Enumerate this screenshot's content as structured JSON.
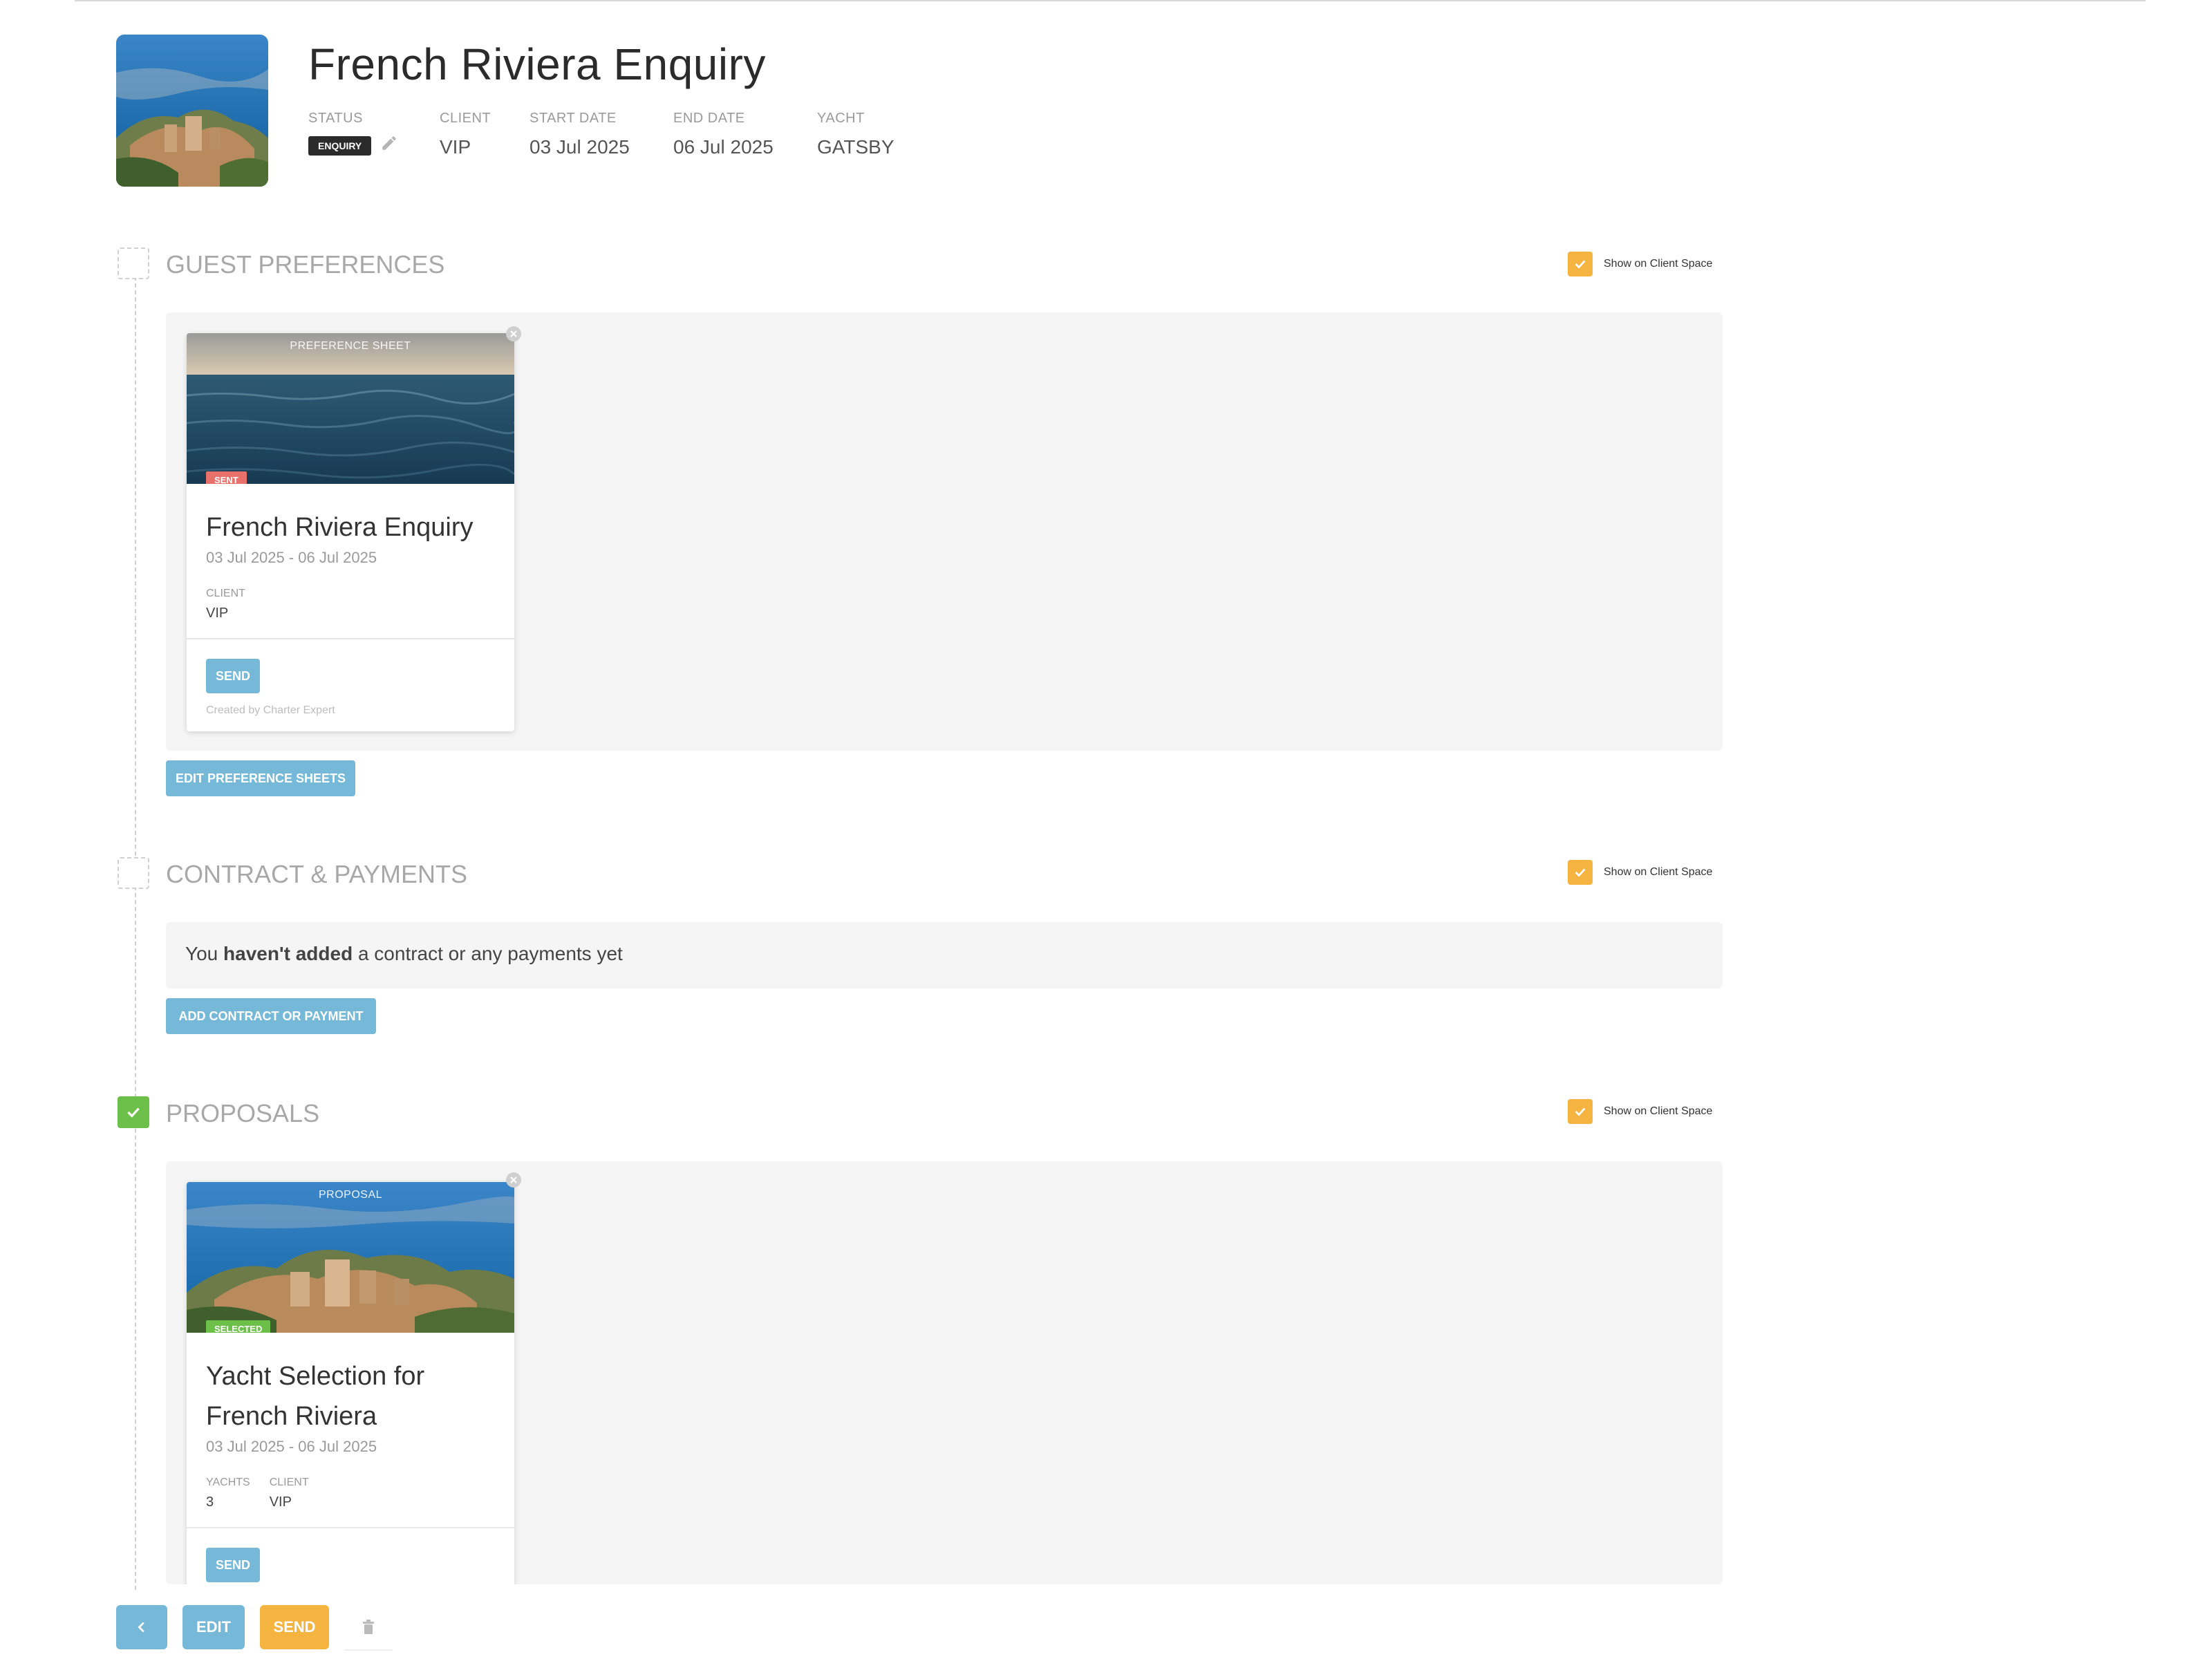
{
  "header": {
    "title": "French Riviera Enquiry",
    "status_label": "STATUS",
    "status_value": "ENQUIRY",
    "client_label": "CLIENT",
    "client_value": "VIP",
    "start_label": "START DATE",
    "start_value": "03 Jul 2025",
    "end_label": "END DATE",
    "end_value": "06 Jul 2025",
    "yacht_label": "YACHT",
    "yacht_value": "GATSBY"
  },
  "sections": {
    "guest": {
      "title": "GUEST PREFERENCES",
      "show_label": "Show on Client Space",
      "card": {
        "kind": "PREFERENCE SHEET",
        "tag": "SENT",
        "title": "French Riviera Enquiry",
        "dates": "03 Jul 2025 - 06 Jul 2025",
        "client_label": "CLIENT",
        "client_value": "VIP",
        "send_label": "SEND",
        "created": "Created by Charter Expert"
      },
      "edit_button": "EDIT PREFERENCE SHEETS"
    },
    "contract": {
      "title": "CONTRACT & PAYMENTS",
      "show_label": "Show on Client Space",
      "msg_prefix": "You ",
      "msg_bold": "haven't added",
      "msg_suffix": " a contract or any payments yet",
      "add_button": "ADD CONTRACT OR PAYMENT"
    },
    "proposals": {
      "title": "PROPOSALS",
      "show_label": "Show on Client Space",
      "card": {
        "kind": "PROPOSAL",
        "tag": "SELECTED",
        "title_line1": "Yacht Selection for",
        "title_line2": "French Riviera",
        "dates": "03 Jul 2025 - 06 Jul 2025",
        "yachts_label": "YACHTS",
        "yachts_value": "3",
        "client_label": "CLIENT",
        "client_value": "VIP",
        "send_label": "SEND"
      }
    }
  },
  "toolbar": {
    "back_icon": "chevron-left-icon",
    "edit_label": "EDIT",
    "send_label": "SEND",
    "delete_icon": "trash-icon"
  },
  "colors": {
    "accent_blue": "#76b8d8",
    "accent_orange": "#f5b340",
    "success_green": "#6cc04a",
    "sent_red": "#e8716b",
    "status_dark": "#2b2b2b"
  }
}
